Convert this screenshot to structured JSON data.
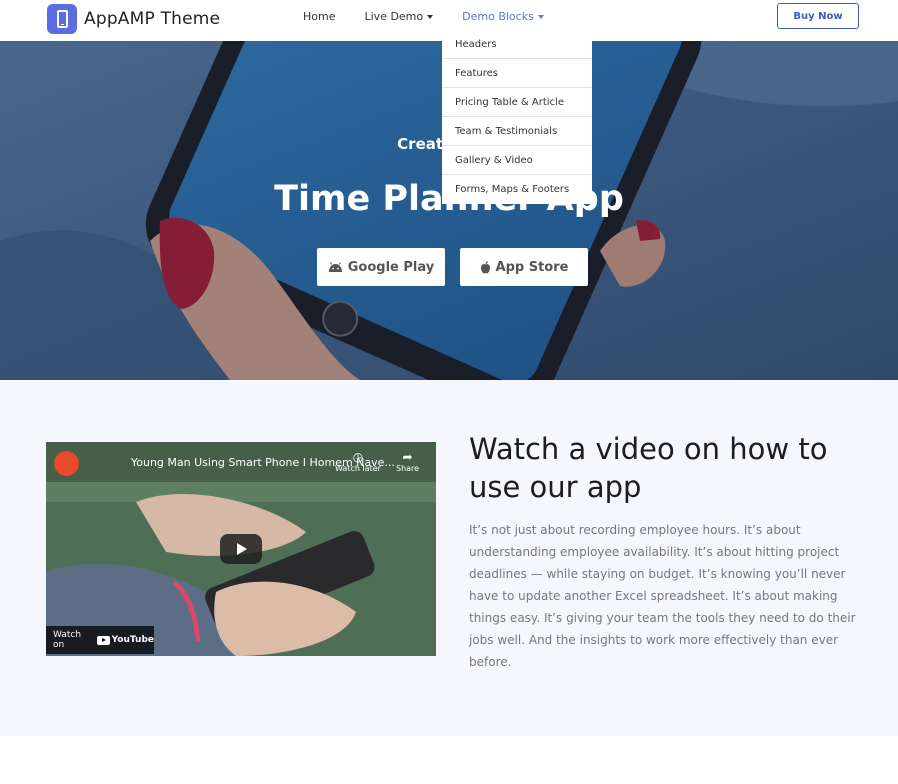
{
  "brand": {
    "name": "AppAMP Theme",
    "logo_icon": "phone-icon",
    "logo_color": "#5b6ee1"
  },
  "nav": {
    "items": [
      {
        "label": "Home",
        "has_caret": false,
        "active": false
      },
      {
        "label": "Live Demo",
        "has_caret": true,
        "active": false
      },
      {
        "label": "Demo Blocks",
        "has_caret": true,
        "active": true
      }
    ],
    "buy_label": "Buy Now"
  },
  "dropdown": {
    "items": [
      {
        "label": "Headers"
      },
      {
        "label": "Features"
      },
      {
        "label": "Pricing Table & Article"
      },
      {
        "label": "Team & Testimonials"
      },
      {
        "label": "Gallery & Video"
      },
      {
        "label": "Forms, Maps & Footers"
      }
    ]
  },
  "hero": {
    "subtitle": "Created to s",
    "title": "Time Planner App",
    "buttons": [
      {
        "label": "Google Play",
        "icon": "android-icon"
      },
      {
        "label": "App Store",
        "icon": "apple-icon"
      }
    ]
  },
  "video": {
    "title": "Young Man Using Smart Phone I Homem Nave...",
    "watch_later": "Watch later",
    "share": "Share",
    "watch_on": "Watch on",
    "youtube": "YouTube"
  },
  "content": {
    "heading": "Watch a video on how to use our app",
    "body": "It’s not just about recording employee hours. It’s about understanding employee availability. It’s about hitting project deadlines — while staying on budget. It’s knowing you’ll never have to update another Excel spreadsheet. It’s about making things easy. It’s giving your team the tools they need to do their jobs well. And the insights to work more effectively than ever before."
  },
  "colors": {
    "accent": "#5b78d6",
    "buy_border": "#3f5bbf",
    "section_bg": "#f5f7fd"
  }
}
